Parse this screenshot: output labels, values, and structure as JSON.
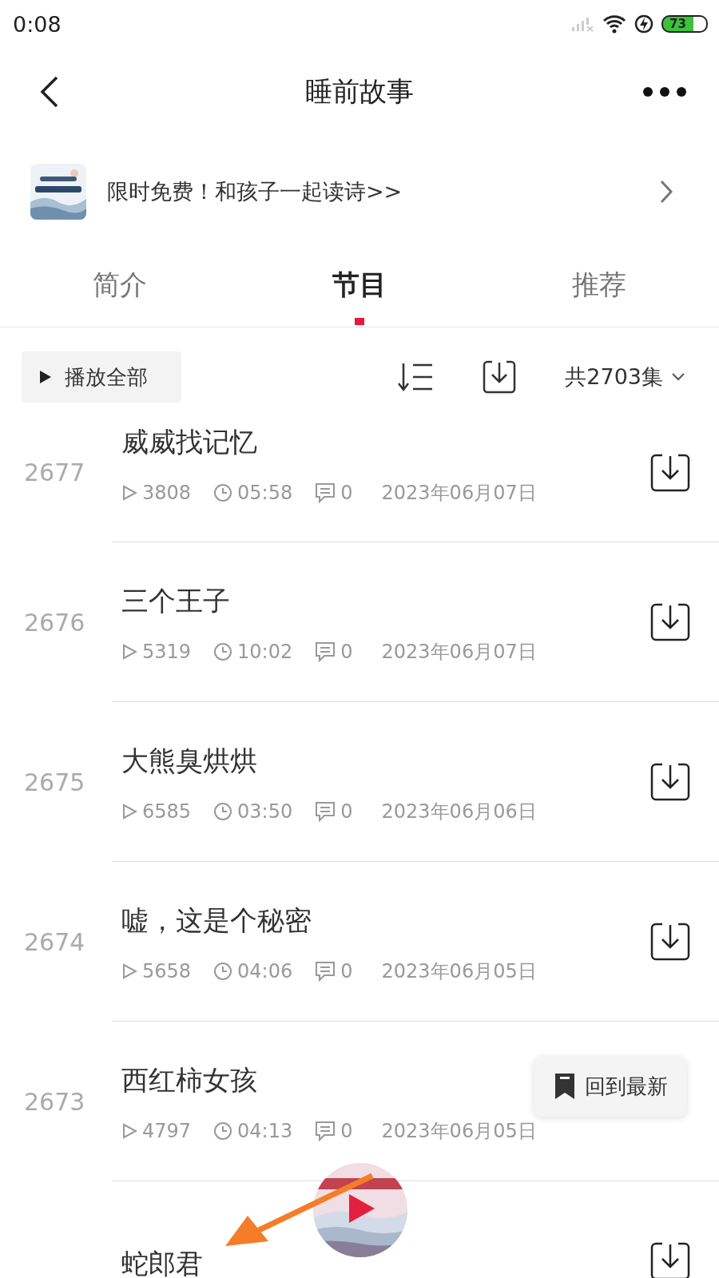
{
  "status_bar": {
    "time": "0:08",
    "battery": "73"
  },
  "header": {
    "title": "睡前故事"
  },
  "banner": {
    "text": "限时免费！和孩子一起读诗>>"
  },
  "tabs": [
    {
      "label": "简介",
      "selected": false
    },
    {
      "label": "节目",
      "selected": true
    },
    {
      "label": "推荐",
      "selected": false
    }
  ],
  "toolbar": {
    "play_all": "播放全部",
    "count": "共2703集"
  },
  "episodes": [
    {
      "number": "2677",
      "title": "威威找记忆",
      "plays": "3808",
      "duration": "05:58",
      "comments": "0",
      "date": "2023年06月07日"
    },
    {
      "number": "2676",
      "title": "三个王子",
      "plays": "5319",
      "duration": "10:02",
      "comments": "0",
      "date": "2023年06月07日"
    },
    {
      "number": "2675",
      "title": "大熊臭烘烘",
      "plays": "6585",
      "duration": "03:50",
      "comments": "0",
      "date": "2023年06月06日"
    },
    {
      "number": "2674",
      "title": "嘘，这是个秘密",
      "plays": "5658",
      "duration": "04:06",
      "comments": "0",
      "date": "2023年06月05日"
    },
    {
      "number": "2673",
      "title": "西红柿女孩",
      "plays": "4797",
      "duration": "04:13",
      "comments": "0",
      "date": "2023年06月05日"
    },
    {
      "title": "蛇郎君"
    }
  ],
  "back_to_latest": {
    "label": "回到最新"
  }
}
